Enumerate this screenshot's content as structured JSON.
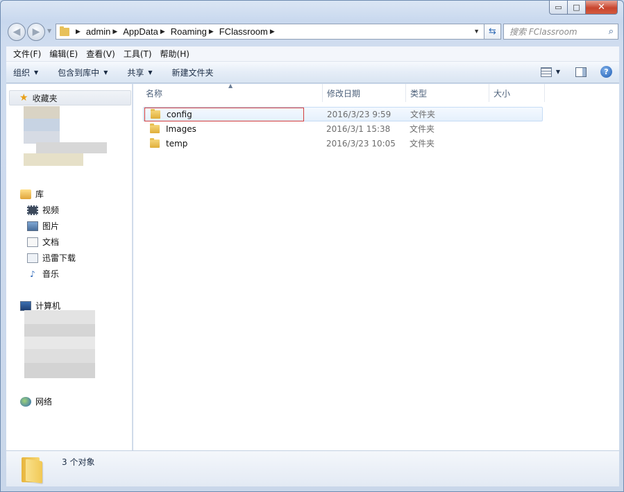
{
  "window": {
    "min_glyph": "▭",
    "max_glyph": "□",
    "close_glyph": "✕"
  },
  "address_bar": {
    "crumbs": [
      "admin",
      "AppData",
      "Roaming",
      "FClassroom"
    ],
    "search_placeholder": "搜索 FClassroom"
  },
  "menu": [
    "文件(F)",
    "编辑(E)",
    "查看(V)",
    "工具(T)",
    "帮助(H)"
  ],
  "commands": [
    "组织",
    "包含到库中",
    "共享",
    "新建文件夹"
  ],
  "navigation": {
    "favorites_label": "收藏夹",
    "libraries_label": "库",
    "library_items": [
      "视频",
      "图片",
      "文档",
      "迅雷下载",
      "音乐"
    ],
    "computer_label": "计算机",
    "network_label": "网络"
  },
  "columns": {
    "name": "名称",
    "date": "修改日期",
    "type": "类型",
    "size": "大小"
  },
  "files": [
    {
      "name": "config",
      "date": "2016/3/23 9:59",
      "type": "文件夹"
    },
    {
      "name": "Images",
      "date": "2016/3/1 15:38",
      "type": "文件夹"
    },
    {
      "name": "temp",
      "date": "2016/3/23 10:05",
      "type": "文件夹"
    }
  ],
  "status": {
    "count_text": "3 个对象"
  },
  "colors": {
    "highlight_border": "#d23c3c",
    "selected_row": "#e5f0fc",
    "folder": "#e8c15a"
  }
}
